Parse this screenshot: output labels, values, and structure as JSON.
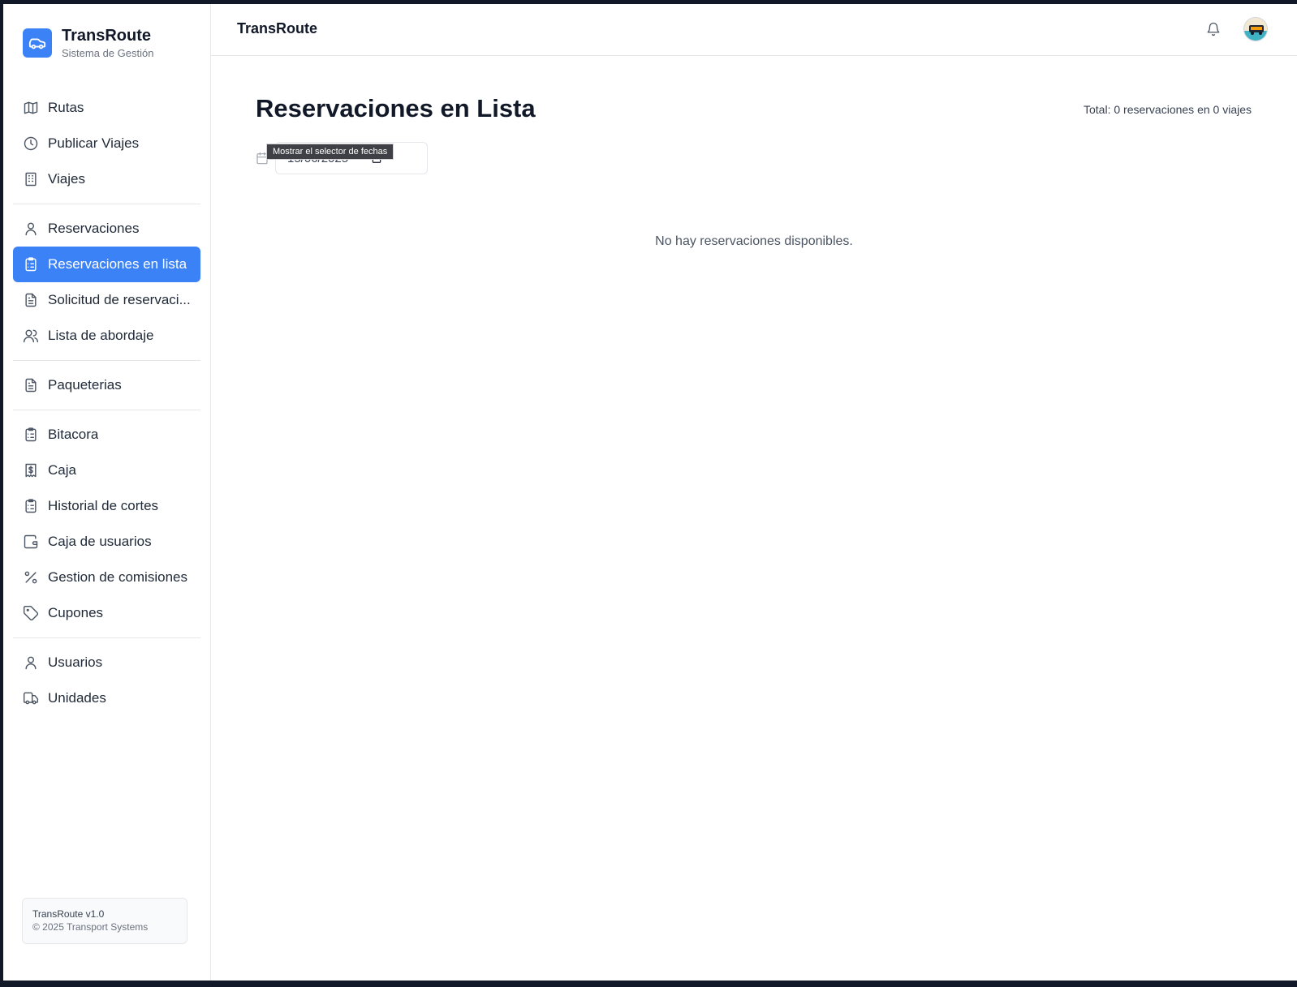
{
  "brand": {
    "title": "TransRoute",
    "subtitle": "Sistema de Gestión"
  },
  "sidebar": {
    "groups": [
      [
        {
          "label": "Rutas",
          "icon": "map-icon"
        },
        {
          "label": "Publicar Viajes",
          "icon": "clock-icon"
        },
        {
          "label": "Viajes",
          "icon": "building-icon"
        }
      ],
      [
        {
          "label": "Reservaciones",
          "icon": "user-icon"
        },
        {
          "label": "Reservaciones en lista",
          "icon": "clipboard-list-icon",
          "active": true
        },
        {
          "label": "Solicitud de reservaci...",
          "icon": "file-text-icon"
        },
        {
          "label": "Lista de abordaje",
          "icon": "users-icon"
        }
      ],
      [
        {
          "label": "Paqueterias",
          "icon": "file-text-icon"
        }
      ],
      [
        {
          "label": "Bitacora",
          "icon": "clipboard-list-icon"
        },
        {
          "label": "Caja",
          "icon": "dollar-receipt-icon"
        },
        {
          "label": "Historial de cortes",
          "icon": "clipboard-list-icon"
        },
        {
          "label": "Caja de usuarios",
          "icon": "wallet-icon"
        },
        {
          "label": "Gestion de comisiones",
          "icon": "percent-icon"
        },
        {
          "label": "Cupones",
          "icon": "tag-icon"
        }
      ],
      [
        {
          "label": "Usuarios",
          "icon": "user-icon"
        },
        {
          "label": "Unidades",
          "icon": "truck-icon"
        }
      ]
    ],
    "footer": {
      "version": "TransRoute v1.0",
      "copyright": "© 2025 Transport Systems"
    }
  },
  "topbar": {
    "title": "TransRoute"
  },
  "main": {
    "title": "Reservaciones en Lista",
    "total": "Total: 0 reservaciones en 0 viajes",
    "date_value": "15/06/2025",
    "date_tooltip": "Mostrar el selector de fechas",
    "empty_message": "No hay reservaciones disponibles."
  },
  "colors": {
    "accent": "#3b82f6",
    "text": "#111827",
    "muted": "#6b7280"
  }
}
